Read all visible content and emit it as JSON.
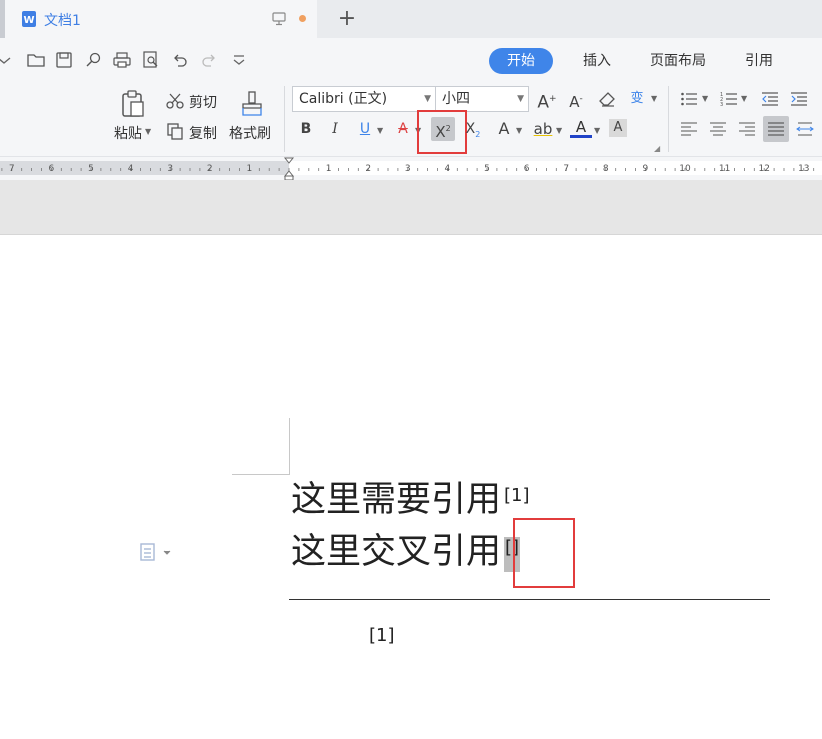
{
  "tabbar": {
    "doc_title": "文档1",
    "new_tab": "+"
  },
  "menu": {
    "tabs": [
      "开始",
      "插入",
      "页面布局",
      "引用"
    ]
  },
  "ribbon": {
    "paste_label": "粘贴",
    "cut_label": "剪切",
    "copy_label": "复制",
    "format_painter_label": "格式刷",
    "font_name": "Calibri (正文)",
    "font_size": "小四",
    "bold": "B",
    "italic": "I",
    "underline": "U",
    "strikethrough": "A"
  },
  "ruler": {
    "left_numbers": [
      "7",
      "6",
      "5",
      "4",
      "3",
      "2",
      "1"
    ],
    "right_numbers": [
      "1",
      "2",
      "3",
      "4",
      "5",
      "6",
      "7",
      "8",
      "9",
      "10",
      "11",
      "12",
      "13"
    ]
  },
  "document": {
    "line1_text": "这里需要引用",
    "line1_ref": "[1]",
    "line2_text": "这里交叉引用",
    "line2_ref": "[]",
    "footnote": "[1]"
  },
  "colors": {
    "accent": "#3f85e9",
    "highlight_box": "#e23c3c",
    "doc_title": "#3f7fe4"
  }
}
